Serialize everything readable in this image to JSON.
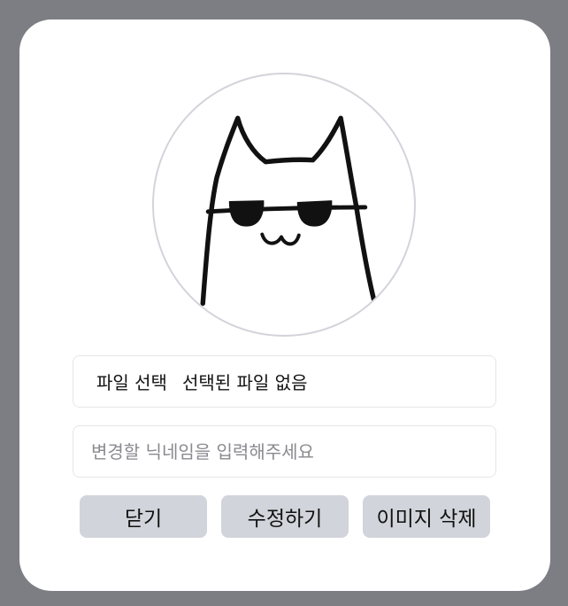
{
  "profile_modal": {
    "avatar_alt": "cat with sunglasses",
    "file_input": {
      "button_label": "파일 선택",
      "status_text": "선택된 파일 없음"
    },
    "nickname_input": {
      "value": "",
      "placeholder": "변경할 닉네임을 입력해주세요"
    },
    "buttons": {
      "close_label": "닫기",
      "edit_label": "수정하기",
      "delete_image_label": "이미지 삭제"
    }
  }
}
